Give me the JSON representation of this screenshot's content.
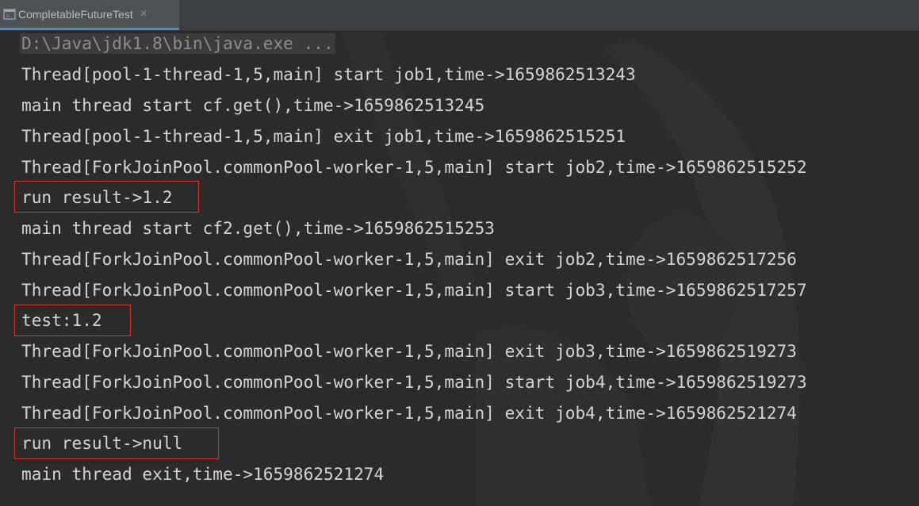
{
  "tab": {
    "title": "CompletableFutureTest",
    "close_glyph": "×",
    "icon": "run-console-icon"
  },
  "console": {
    "command": "D:\\Java\\jdk1.8\\bin\\java.exe ...",
    "lines": [
      "Thread[pool-1-thread-1,5,main] start job1,time->1659862513243",
      "main thread start cf.get(),time->1659862513245",
      "Thread[pool-1-thread-1,5,main] exit job1,time->1659862515251",
      "Thread[ForkJoinPool.commonPool-worker-1,5,main] start job2,time->1659862515252",
      "run result->1.2",
      "main thread start cf2.get(),time->1659862515253",
      "Thread[ForkJoinPool.commonPool-worker-1,5,main] exit job2,time->1659862517256",
      "Thread[ForkJoinPool.commonPool-worker-1,5,main] start job3,time->1659862517257",
      "test:1.2",
      "Thread[ForkJoinPool.commonPool-worker-1,5,main] exit job3,time->1659862519273",
      "Thread[ForkJoinPool.commonPool-worker-1,5,main] start job4,time->1659862519273",
      "Thread[ForkJoinPool.commonPool-worker-1,5,main] exit job4,time->1659862521274",
      "run result->null",
      "main thread exit,time->1659862521274"
    ]
  },
  "colors": {
    "background": "#2b2b2b",
    "text": "#d4d4d4",
    "command_text": "#8d8d8d",
    "highlight_box": "#d9372e",
    "tab_accent": "#4a88c7"
  }
}
